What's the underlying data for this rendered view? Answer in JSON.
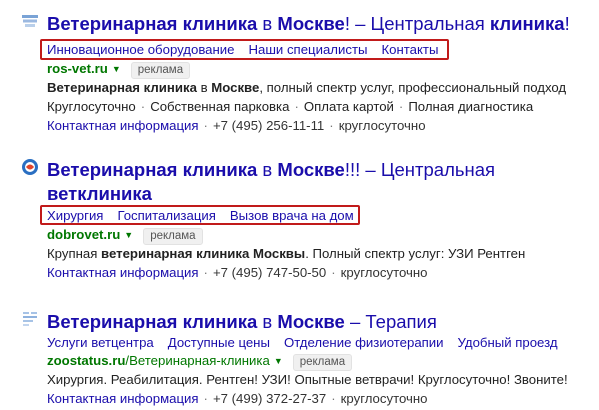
{
  "ads": [
    {
      "title_parts": [
        "Ветеринарная клиника",
        " в ",
        "Москве",
        "! – Центральная ",
        "клиника",
        "!"
      ],
      "sitelinks": [
        "Инновационное оборудование",
        "Наши специалисты",
        "Контакты"
      ],
      "url": "ros-vet.ru",
      "badge": "реклама",
      "desc_parts": [
        "Ветеринарная клиника",
        " в ",
        "Москве",
        ", полный спектр услуг, профессиональный подход"
      ],
      "features": [
        "Круглосуточно",
        "Собственная парковка",
        "Оплата картой",
        "Полная диагностика"
      ],
      "contact_link": "Контактная информация",
      "phone": "+7 (495) 256-11-11",
      "hours": "круглосуточно",
      "favicon": "rosvet-logo-icon"
    },
    {
      "title_line1_parts": [
        "Ветеринарная клиника",
        " в ",
        "Москве",
        "!!! – Центральная"
      ],
      "title_line2": "ветклиника",
      "sitelinks": [
        "Хирургия",
        "Госпитализация",
        "Вызов врача на дом"
      ],
      "url": "dobrovet.ru",
      "badge": "реклама",
      "desc_parts": [
        "Крупная ",
        "ветеринарная клиника Москвы",
        ". Полный спектр услуг: УЗИ Рентген"
      ],
      "contact_link": "Контактная информация",
      "phone": "+7 (495) 747-50-50",
      "hours": "круглосуточно",
      "favicon": "dobrovet-logo-icon"
    },
    {
      "title_parts": [
        "Ветеринарная клиника",
        " в ",
        "Москве",
        " – Терапия"
      ],
      "sitelinks": [
        "Услуги ветцентра",
        "Доступные цены",
        "Отделение физиотерапии",
        "Удобный проезд"
      ],
      "url": "zoostatus.ru",
      "url_path": "/Ветеринарная-клиника",
      "badge": "реклама",
      "desc": "Хирургия. Реабилитация. Рентген! УЗИ! Опытные ветврачи! Круглосуточно! Звоните!",
      "contact_link": "Контактная информация",
      "phone": "+7 (499) 372-27-37",
      "hours": "круглосуточно",
      "favicon": "zoostatus-logo-icon"
    }
  ],
  "colors": {
    "title": "#1a0dab",
    "url": "#007700",
    "highlight_box": "#c11a1a"
  }
}
